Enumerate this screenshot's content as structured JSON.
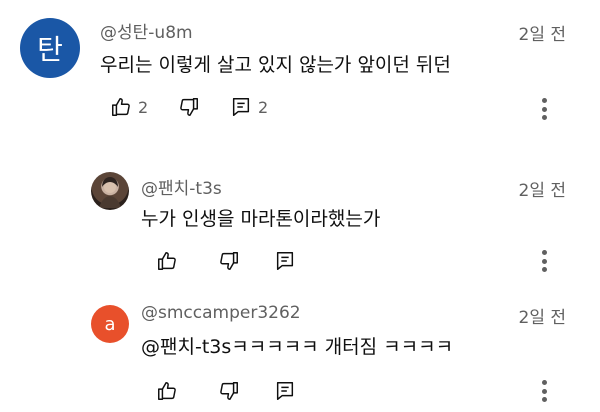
{
  "colors": {
    "avatar1_bg": "#1a57a6",
    "avatar3_bg": "#e8502b",
    "meta_text": "#606060",
    "body_text": "#0f0f0f"
  },
  "comments": [
    {
      "avatar_letter": "탄",
      "author": "@성탄-u8m",
      "time": "2일 전",
      "text": "우리는 이렇게 살고 있지 않는가 앞이던 뒤던",
      "likes": "2",
      "replies": "2"
    },
    {
      "author": "@팬치-t3s",
      "time": "2일 전",
      "text": "누가 인생을 마라톤이라했는가"
    },
    {
      "avatar_letter": "a",
      "author": "@smccamper3262",
      "time": "2일 전",
      "text": "@팬치-t3sㅋㅋㅋㅋㅋ 개터짐 ㅋㅋㅋㅋ"
    }
  ]
}
